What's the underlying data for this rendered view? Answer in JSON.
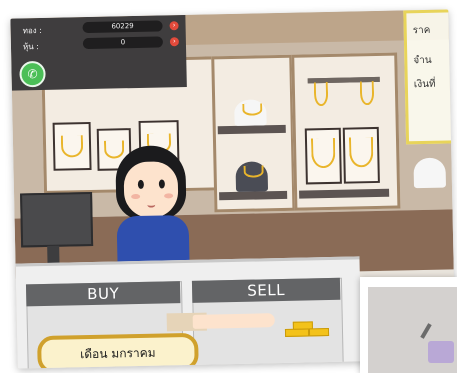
{
  "stats": {
    "gold_label": "ทอง :",
    "gold_value": "60229",
    "stock_label": "หุ้น :",
    "stock_value": "0"
  },
  "right_panel": {
    "line1": "ราค",
    "line2": "จำน",
    "line3": "เงินที่"
  },
  "actions": {
    "buy_label": "BUY",
    "sell_label": "SELL"
  },
  "month_label": "เดือน มกราคม",
  "colors": {
    "gold": "#f3c21a",
    "panel_dark": "#3f3d3e",
    "phone_green": "#4bbf57",
    "button_gray": "#636466",
    "month_border": "#d0a12c"
  }
}
